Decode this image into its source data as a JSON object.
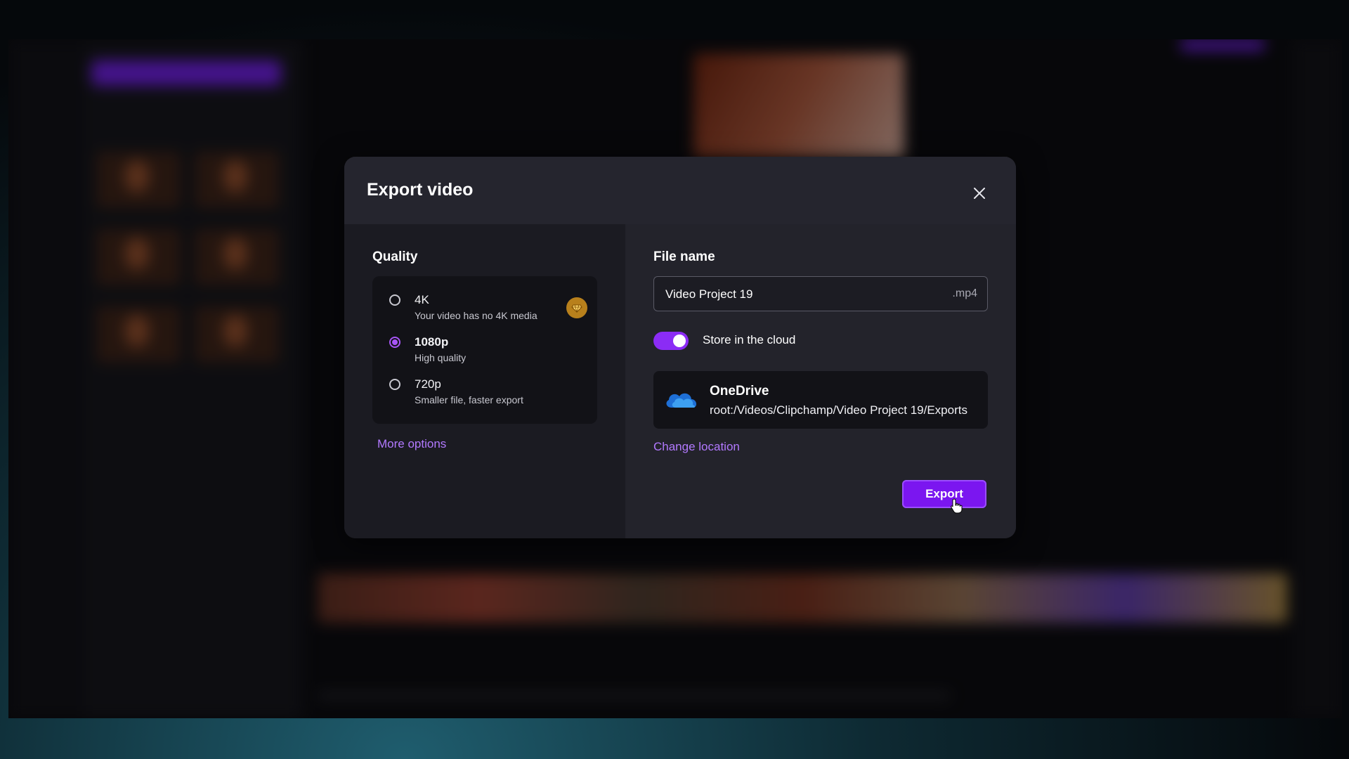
{
  "dialog": {
    "title": "Export video"
  },
  "quality": {
    "title": "Quality",
    "options": [
      {
        "label": "4K",
        "sub": "Your video has no 4K media",
        "selected": false,
        "premium": true
      },
      {
        "label": "1080p",
        "sub": "High quality",
        "selected": true,
        "premium": false
      },
      {
        "label": "720p",
        "sub": "Smaller file, faster export",
        "selected": false,
        "premium": false
      }
    ],
    "more_options": "More options"
  },
  "file": {
    "title": "File name",
    "value": "Video Project 19",
    "extension": ".mp4"
  },
  "cloud": {
    "toggle_label": "Store in the cloud",
    "enabled": true,
    "provider": "OneDrive",
    "path": "root:/Videos/Clipchamp/Video Project 19/Exports",
    "change_location": "Change location"
  },
  "actions": {
    "export_label": "Export"
  },
  "colors": {
    "accent": "#8b2cf5",
    "link": "#b279ff",
    "premium": "#b8801c"
  }
}
